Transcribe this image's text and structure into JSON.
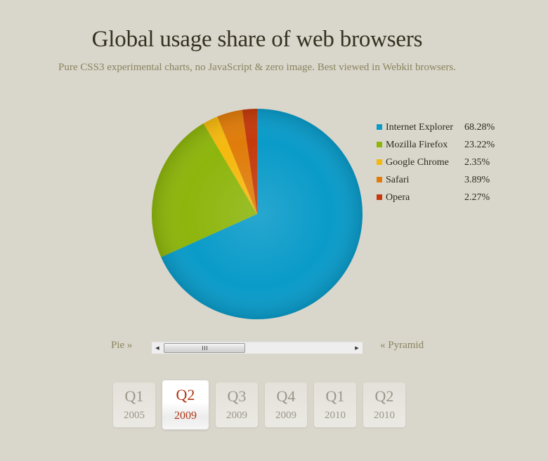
{
  "header": {
    "title": "Global usage share of web browsers",
    "subtitle": "Pure CSS3 experimental charts, no JavaScript & zero image. Best viewed in Webkit browsers."
  },
  "chart_data": {
    "type": "pie",
    "title": "Global usage share of web browsers",
    "period": "Q2 2009",
    "start": "12 o'clock, clockwise",
    "categories": [
      "Internet Explorer",
      "Mozilla Firefox",
      "Google Chrome",
      "Safari",
      "Opera"
    ],
    "values": [
      68.28,
      23.22,
      2.35,
      3.89,
      2.27
    ],
    "value_labels": [
      "68.28%",
      "23.22%",
      "2.35%",
      "3.89%",
      "2.27%"
    ],
    "colors": [
      "#0a9bc9",
      "#8db50c",
      "#f5b90e",
      "#e07c0a",
      "#c43a0c"
    ],
    "legend_position": "right"
  },
  "nav": {
    "prev_label": "Pie »",
    "next_label": "« Pyramid",
    "scroll_position": 0,
    "scroll_left_icon": "◀",
    "scroll_right_icon": "▶"
  },
  "tabs": [
    {
      "quarter": "Q1",
      "year": "2005",
      "active": false
    },
    {
      "quarter": "Q2",
      "year": "2009",
      "active": true
    },
    {
      "quarter": "Q3",
      "year": "2009",
      "active": false
    },
    {
      "quarter": "Q4",
      "year": "2009",
      "active": false
    },
    {
      "quarter": "Q1",
      "year": "2010",
      "active": false
    },
    {
      "quarter": "Q2",
      "year": "2010",
      "active": false
    }
  ]
}
